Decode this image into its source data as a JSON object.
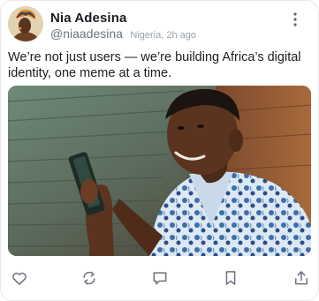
{
  "post": {
    "author_name": "Nia Adesina",
    "handle": "@niaadesina",
    "location_time": "Nigeria, 2h ago",
    "text": "We’re not just users — we’re building Africa’s digital identity, one meme at a time."
  },
  "icons": {
    "more": "more-vertical-icon",
    "like": "heart-icon",
    "repost": "repost-icon",
    "comment": "comment-icon",
    "save": "bookmark-icon",
    "share": "share-icon"
  },
  "colors": {
    "text_primary": "#1a1d21",
    "text_secondary": "#6b7480",
    "icon": "#6b7480",
    "border": "#e6e8ec"
  }
}
